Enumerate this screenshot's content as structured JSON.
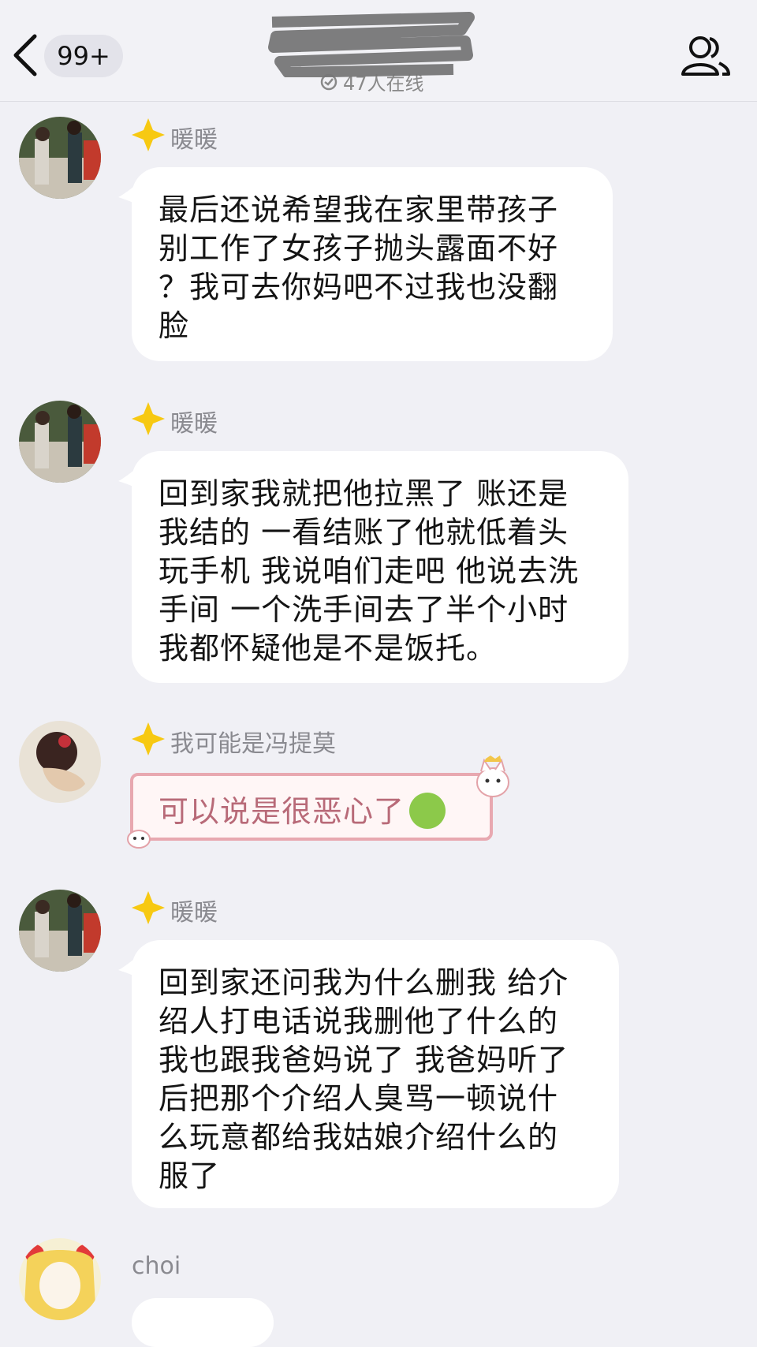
{
  "header": {
    "badge": "99+",
    "online_text": "47人在线"
  },
  "messages": [
    {
      "sender": "暖暖",
      "text": "最后还说希望我在家里带孩子\n别工作了女孩子抛头露面不好\n？我可去你妈吧不过我也没翻\n脸"
    },
    {
      "sender": "暖暖",
      "text": "回到家我就把他拉黑了 账还是\n我结的 一看结账了他就低着头\n玩手机 我说咱们走吧 他说去洗\n手间 一个洗手间去了半个小时\n我都怀疑他是不是饭托。"
    },
    {
      "sender": "我可能是冯提莫",
      "text": "可以说是很恶心了",
      "emoji": "nauseated-face-icon"
    },
    {
      "sender": "暖暖",
      "text": "回到家还问我为什么删我 给介\n绍人打电话说我删他了什么的\n我也跟我爸妈说了 我爸妈听了\n后把那个介绍人臭骂一顿说什\n么玩意都给我姑娘介绍什么的\n服了"
    },
    {
      "sender": "choi",
      "text": ""
    }
  ]
}
